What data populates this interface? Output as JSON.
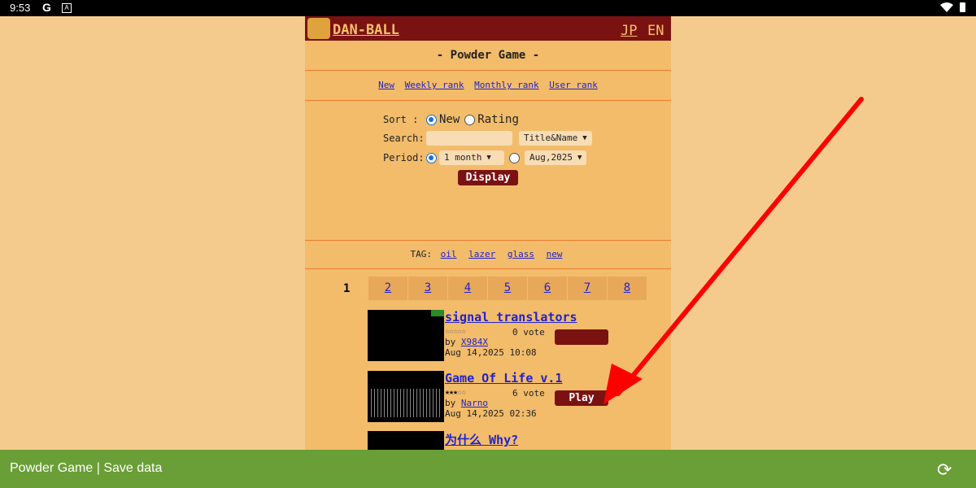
{
  "statusbar": {
    "time": "9:53",
    "g": "G",
    "a": "A"
  },
  "site": {
    "logo_text": "DAN-BALL",
    "lang_jp": "JP",
    "lang_en": "EN"
  },
  "page_title": "- Powder Game -",
  "nav": {
    "new": "New",
    "weekly": "Weekly rank",
    "monthly": "Monthly rank",
    "user": "User rank"
  },
  "form": {
    "sort_label": "Sort :",
    "sort_new": "New",
    "sort_rating": "Rating",
    "search_label": "Search:",
    "search_value": "",
    "search_scope": "Title&Name",
    "period_label": "Period:",
    "period_recent": "1 month",
    "period_month": "Aug,2025",
    "display_button": "Display"
  },
  "tags": {
    "label": "TAG:",
    "items": [
      "oil",
      "lazer",
      "glass",
      "new"
    ]
  },
  "pager": {
    "current": "1",
    "pages": [
      "2",
      "3",
      "4",
      "5",
      "6",
      "7",
      "8"
    ]
  },
  "items": [
    {
      "title": "signal translators",
      "votes": "0 vote",
      "by_label": "by",
      "author": "X984X",
      "date": "Aug 14,2025 10:08",
      "rating": 0,
      "play": ""
    },
    {
      "title": "Game Of Life v.1",
      "votes": "6 vote",
      "by_label": "by",
      "author": "Narno",
      "date": "Aug 14,2025 02:36",
      "rating": 3,
      "play": "Play"
    },
    {
      "title": "为什么 Why?"
    }
  ],
  "bottombar": {
    "text": "Powder Game | Save data"
  },
  "colors": {
    "header": "#7b1212",
    "page": "#f2bc6b",
    "background": "#f5cb8d",
    "bottombar": "#6a9e36",
    "arrow": "#ff0000"
  },
  "icons": [
    "wifi-icon",
    "battery-icon",
    "sync-icon",
    "chevron-down-icon",
    "logo-icon"
  ]
}
